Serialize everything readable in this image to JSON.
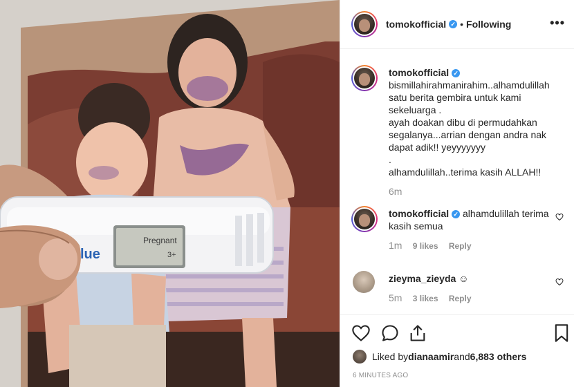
{
  "post": {
    "username": "tomokofficial",
    "separator": "•",
    "follow_status": "Following",
    "more_label": "•••",
    "test_brand": "lue",
    "test_screen_line1": "Pregnant",
    "test_screen_line2": "3+"
  },
  "caption": {
    "username": "tomokofficial",
    "lines": [
      "bismillahirahmanirahim..alhamdulillah",
      "satu berita gembira untuk kami",
      "sekeluarga .",
      "ayah doakan dibu di permudahkan",
      "segalanya...arrian dengan andra nak",
      "dapat adik!! yeyyyyyyy",
      ".",
      "alhamdulillah..terima kasih ALLAH!!"
    ],
    "age": "6m"
  },
  "comments": [
    {
      "username": "tomokofficial",
      "verified": true,
      "text": "alhamdulillah terima kasih semua",
      "age": "1m",
      "likes": "9 likes",
      "reply": "Reply"
    },
    {
      "username": "zieyma_zieyda",
      "verified": false,
      "text": "☺",
      "age": "5m",
      "likes": "3 likes",
      "reply": "Reply"
    }
  ],
  "actions": {
    "icons": [
      "heart-icon",
      "comment-icon",
      "share-icon",
      "bookmark-icon"
    ],
    "liked_by_prefix": "Liked by ",
    "liked_by_user": "dianaamir",
    "liked_by_and": " and ",
    "liked_by_count": "6,883 others",
    "time_ago": "6 MINUTES AGO"
  },
  "colors": {
    "verified": "#3897f0",
    "meta_text": "#8e8e8e",
    "border": "#efefef"
  }
}
